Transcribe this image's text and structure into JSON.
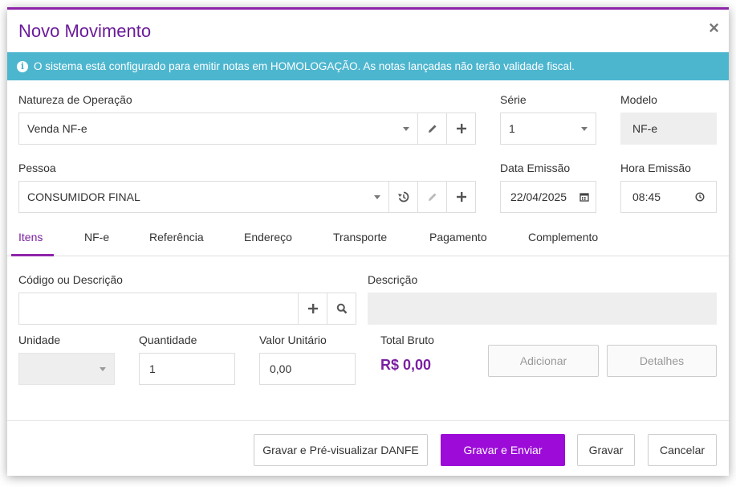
{
  "dialog": {
    "title": "Novo Movimento",
    "close_label": "×"
  },
  "banner": {
    "icon": "info-icon",
    "text": "O sistema está configurado para emitir notas em HOMOLOGAÇÃO. As notas lançadas não terão validade fiscal."
  },
  "natureza": {
    "label": "Natureza de Operação",
    "value": "Venda NF-e"
  },
  "serie": {
    "label": "Série",
    "value": "1"
  },
  "modelo": {
    "label": "Modelo",
    "value": "NF-e"
  },
  "pessoa": {
    "label": "Pessoa",
    "value": "CONSUMIDOR FINAL"
  },
  "data_emissao": {
    "label": "Data Emissão",
    "value": "22/04/2025"
  },
  "hora_emissao": {
    "label": "Hora Emissão",
    "value": "08:45"
  },
  "tabs": [
    {
      "label": "Itens",
      "active": true
    },
    {
      "label": "NF-e"
    },
    {
      "label": "Referência"
    },
    {
      "label": "Endereço"
    },
    {
      "label": "Transporte"
    },
    {
      "label": "Pagamento"
    },
    {
      "label": "Complemento"
    }
  ],
  "item": {
    "codigo_label": "Código ou Descrição",
    "codigo_value": "",
    "descricao_label": "Descrição",
    "descricao_value": "",
    "unidade_label": "Unidade",
    "unidade_value": "",
    "quantidade_label": "Quantidade",
    "quantidade_value": "1",
    "valor_label": "Valor Unitário",
    "valor_value": "0,00",
    "total_label": "Total Bruto",
    "total_value": "R$ 0,00",
    "adicionar_label": "Adicionar",
    "detalhes_label": "Detalhes"
  },
  "footer": {
    "preview_label": "Gravar e Pré-visualizar DANFE",
    "send_label": "Gravar e Enviar",
    "save_label": "Gravar",
    "cancel_label": "Cancelar"
  },
  "colors": {
    "accent": "#8e24aa",
    "primary_button": "#9c0bd8",
    "banner": "#4db6cf"
  }
}
